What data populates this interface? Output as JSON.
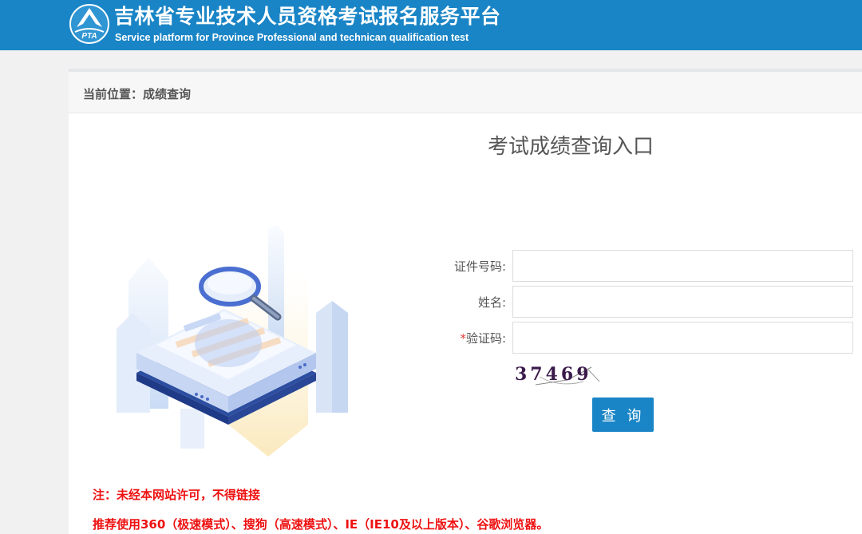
{
  "header": {
    "logo_text": "PTA",
    "title": "吉林省专业技术人员资格考试报名服务平台",
    "subtitle": "Service platform for Province Professional and technican qualification test"
  },
  "breadcrumb": "当前位置：成绩查询",
  "form": {
    "title": "考试成绩查询入口",
    "id_label": "证件号码:",
    "id_value": "",
    "name_label": "姓名:",
    "name_value": "",
    "captcha_required_mark": "*",
    "captcha_label": "验证码:",
    "captcha_value": "",
    "captcha_image_text": "37469",
    "submit_label": "查 询"
  },
  "notices": [
    "注：未经本网站许可，不得链接",
    "推荐使用360（极速模式）、搜狗（高速模式）、IE（IE10及以上版本）、谷歌浏览器。"
  ],
  "colors": {
    "header_bg": "#1a85c6",
    "notice_red": "#ee1111",
    "button_bg": "#1a85c6"
  },
  "icons": [
    "pta-logo",
    "search-illustration"
  ]
}
